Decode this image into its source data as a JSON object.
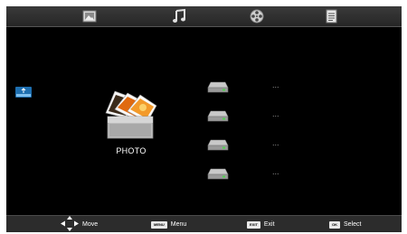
{
  "top_tabs": [
    {
      "icon": "photo-tab-icon"
    },
    {
      "icon": "music-tab-icon"
    },
    {
      "icon": "movie-tab-icon"
    },
    {
      "icon": "text-tab-icon"
    }
  ],
  "source": {
    "icon": "usb-device-icon"
  },
  "main": {
    "label": "PHOTO",
    "icon": "photo-folder-icon"
  },
  "drives": [
    {
      "icon": "drive-icon",
      "name": "..."
    },
    {
      "icon": "drive-icon",
      "name": "..."
    },
    {
      "icon": "drive-icon",
      "name": "..."
    },
    {
      "icon": "drive-icon",
      "name": "..."
    }
  ],
  "hints": {
    "move_label": "Move",
    "menu_key": "MENU",
    "menu_label": "Menu",
    "exit_key": "EXIT",
    "exit_label": "Exit",
    "ok_key": "OK",
    "select_label": "Select"
  },
  "colors": {
    "background": "#000000",
    "bar": "#2c2c2c",
    "accent": "#f07a10"
  }
}
